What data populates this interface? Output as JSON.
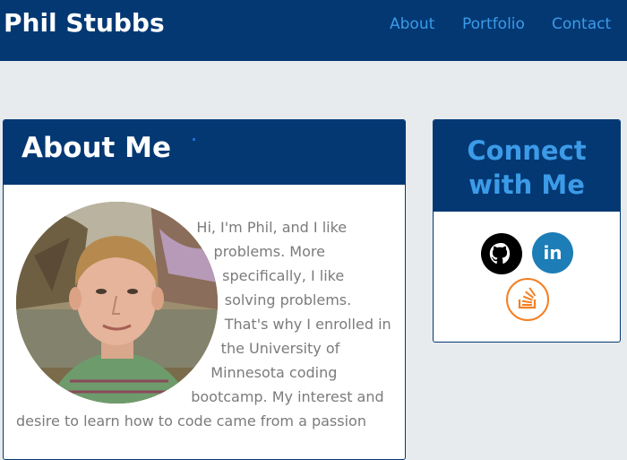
{
  "navbar": {
    "brand": "Phil Stubbs",
    "links": [
      "About",
      "Portfolio",
      "Contact"
    ]
  },
  "about": {
    "title": "About Me",
    "text": "Hi, I'm Phil, and I like problems. More specifically, I like solving problems. That's why I enrolled in the University of Minnesota coding bootcamp. My interest and desire to learn how to code came from a passion"
  },
  "connect": {
    "title": "Connect with Me",
    "icons": [
      "github-icon",
      "linkedin-icon",
      "stack-overflow-icon"
    ],
    "linkedin_label": "in"
  },
  "colors": {
    "navbar_bg": "#033873",
    "link": "#3c9be8",
    "page_bg": "#e8ebee",
    "linkedin": "#1d7db6",
    "stackoverflow": "#f48024"
  }
}
